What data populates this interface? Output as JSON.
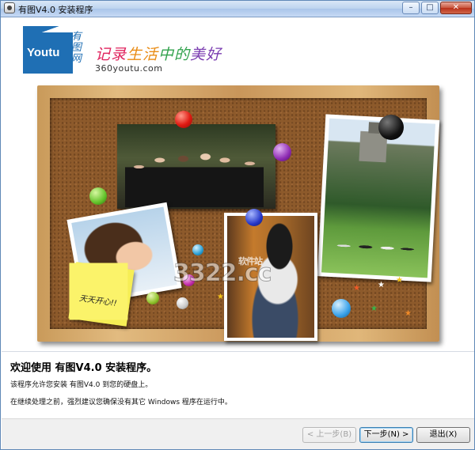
{
  "window": {
    "title": "有图V4.0 安装程序",
    "controls": {
      "minimize": "–",
      "maximize": "□",
      "close": "✕"
    }
  },
  "banner": {
    "logo_word": "Youtu",
    "logo_cn": "有图网",
    "slogan": [
      "记录",
      "生活",
      "中的",
      "美好"
    ],
    "url": "360youtu.com",
    "note_text": "天天开心!!",
    "watermark": "3322.cc",
    "watermark_small": "软件站"
  },
  "content": {
    "welcome": "欢迎使用 有图V4.0 安装程序。",
    "line1": "该程序允许您安装 有图V4.0 到您的硬盘上。",
    "line2": "在继续处理之前，强烈建议您确保没有其它 Windows 程序在运行中。"
  },
  "buttons": {
    "back": "< 上一步(B)",
    "next": "下一步(N) >",
    "exit": "退出(X)"
  },
  "colors": {
    "accent": "#1f6fb4",
    "cork": "#8d5a2b",
    "frame": "#d9ad6e"
  }
}
